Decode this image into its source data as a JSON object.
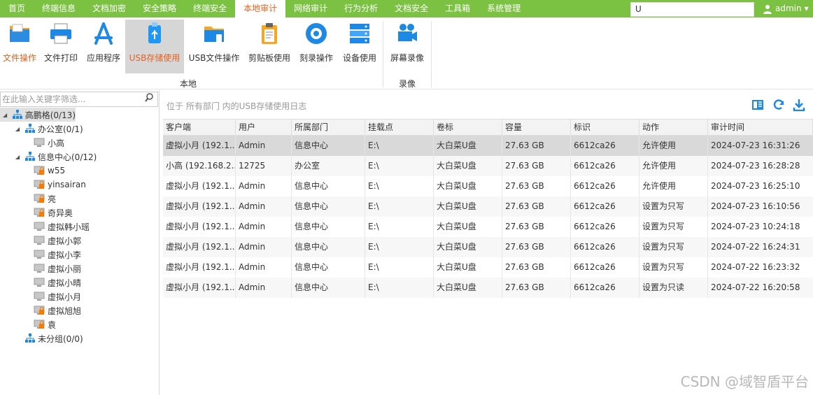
{
  "menu": [
    {
      "label": "首页"
    },
    {
      "label": "终端信息"
    },
    {
      "label": "文档加密"
    },
    {
      "label": "安全策略"
    },
    {
      "label": "终端安全"
    },
    {
      "label": "本地审计",
      "active": true
    },
    {
      "label": "网络审计"
    },
    {
      "label": "行为分析"
    },
    {
      "label": "文档安全"
    },
    {
      "label": "工具箱"
    },
    {
      "label": "系统管理"
    }
  ],
  "search": {
    "value": "U"
  },
  "user": {
    "name": "admin",
    "arrow": "▾"
  },
  "ribbon": {
    "tools": [
      {
        "label": "文件操作",
        "icon": "file-folder-icon"
      },
      {
        "label": "文件打印",
        "icon": "printer-icon"
      },
      {
        "label": "应用程序",
        "icon": "app-store-icon"
      },
      {
        "label": "USB存储使用",
        "icon": "usb-drive-icon",
        "selected": true
      },
      {
        "label": "USB文件操作",
        "icon": "usb-folder-icon"
      },
      {
        "label": "剪贴板使用",
        "icon": "clipboard-icon"
      },
      {
        "label": "刻录操作",
        "icon": "disc-icon"
      },
      {
        "label": "设备使用",
        "icon": "device-icon"
      },
      {
        "label": "屏幕录像",
        "icon": "video-camera-icon"
      }
    ],
    "group_local": "本地",
    "group_record": "录像"
  },
  "left": {
    "filter_placeholder": "在此输入关键字筛选...",
    "tree": [
      {
        "label": "高鹏格(0/13)",
        "type": "org",
        "level": 0,
        "toggle": "◢",
        "selected": true
      },
      {
        "label": "办公室(0/1)",
        "type": "org",
        "level": 1,
        "toggle": "◢"
      },
      {
        "label": "小高",
        "type": "pc",
        "level": 2
      },
      {
        "label": "信息中心(0/12)",
        "type": "org",
        "level": 1,
        "toggle": "◢"
      },
      {
        "label": "w55",
        "type": "pc-lock",
        "level": 2
      },
      {
        "label": "yinsairan",
        "type": "pc-lock",
        "level": 2
      },
      {
        "label": "亮",
        "type": "pc-lock",
        "level": 2
      },
      {
        "label": "奇异奥",
        "type": "pc-lock",
        "level": 2
      },
      {
        "label": "虚拟韩小瑶",
        "type": "pc",
        "level": 2
      },
      {
        "label": "虚拟小郭",
        "type": "pc",
        "level": 2
      },
      {
        "label": "虚拟小李",
        "type": "pc",
        "level": 2
      },
      {
        "label": "虚拟小丽",
        "type": "pc",
        "level": 2
      },
      {
        "label": "虚拟小晴",
        "type": "pc",
        "level": 2
      },
      {
        "label": "虚拟小月",
        "type": "pc",
        "level": 2
      },
      {
        "label": "虚拟旭旭",
        "type": "pc-lock",
        "level": 2
      },
      {
        "label": "袁",
        "type": "pc-lock",
        "level": 2
      },
      {
        "label": "未分组(0/0)",
        "type": "org",
        "level": 1
      }
    ]
  },
  "right": {
    "location_text": "位于 所有部门 内的USB存储使用日志",
    "columns": [
      "客户端",
      "用户",
      "所属部门",
      "挂载点",
      "卷标",
      "容量",
      "标识",
      "动作",
      "审计时间"
    ],
    "rows": [
      [
        "虚拟小月 (192.1...",
        "Admin",
        "信息中心",
        "E:\\",
        "大白菜U盘",
        "27.63 GB",
        "6612ca26",
        "允许使用",
        "2024-07-23 16:31:26"
      ],
      [
        "小高 (192.168.2...",
        "12725",
        "办公室",
        "E:\\",
        "大白菜U盘",
        "27.63 GB",
        "6612ca26",
        "允许使用",
        "2024-07-23 16:28:28"
      ],
      [
        "虚拟小月 (192.1...",
        "Admin",
        "信息中心",
        "E:\\",
        "大白菜U盘",
        "27.63 GB",
        "6612ca26",
        "允许使用",
        "2024-07-23 16:25:10"
      ],
      [
        "虚拟小月 (192.1...",
        "Admin",
        "信息中心",
        "E:\\",
        "大白菜U盘",
        "27.63 GB",
        "6612ca26",
        "设置为只写",
        "2024-07-23 16:10:56"
      ],
      [
        "虚拟小月 (192.1...",
        "Admin",
        "信息中心",
        "E:\\",
        "大白菜U盘",
        "27.63 GB",
        "6612ca26",
        "设置为只写",
        "2024-07-23 10:24:18"
      ],
      [
        "虚拟小月 (192.1...",
        "Admin",
        "信息中心",
        "E:\\",
        "大白菜U盘",
        "27.63 GB",
        "6612ca26",
        "设置为只写",
        "2024-07-22 16:24:31"
      ],
      [
        "虚拟小月 (192.1...",
        "Admin",
        "信息中心",
        "E:\\",
        "大白菜U盘",
        "27.63 GB",
        "6612ca26",
        "设置为只写",
        "2024-07-22 16:23:32"
      ],
      [
        "虚拟小月 (192.1...",
        "Admin",
        "信息中心",
        "E:\\",
        "大白菜U盘",
        "27.63 GB",
        "6612ca26",
        "设置为只读",
        "2024-07-22 16:20:58"
      ]
    ]
  },
  "watermark": "CSDN @域智盾平台",
  "colors": {
    "menu_bg": "#7cc242",
    "accent": "#e8611d",
    "icon_blue": "#1e88e5"
  }
}
